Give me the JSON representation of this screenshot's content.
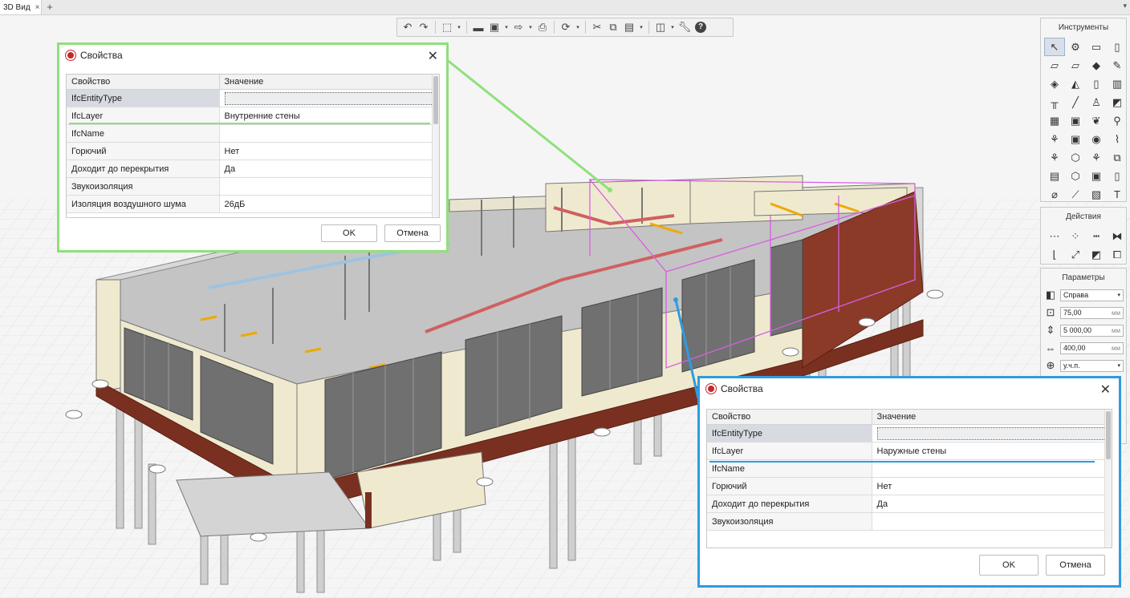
{
  "tab": {
    "label": "3D Вид",
    "close": "×",
    "add": "+",
    "menu": "▾"
  },
  "toolbar": {
    "icons": [
      "undo-icon",
      "redo-icon",
      "view-cube-icon",
      "folder-icon",
      "save-icon",
      "export-icon",
      "print-icon",
      "orbit-icon",
      "cut-icon",
      "copy-icon",
      "paste-icon",
      "layers-icon",
      "wrench-icon",
      "help-icon"
    ]
  },
  "tools_panel": {
    "title": "Инструменты",
    "icons": [
      "↖",
      "⚙",
      "▭",
      "▯",
      "▱",
      "▱",
      "◆",
      "✎",
      "◈",
      "◭",
      "▯",
      "▥",
      "╥",
      "╱",
      "♙",
      "◩",
      "▦",
      "▣",
      "❦",
      "⚲",
      "⚘",
      "▣",
      "◉",
      "⌇",
      "⚘",
      "⬡",
      "⚘",
      "⧉",
      "▤",
      "⬡",
      "▣",
      "▯",
      "⌀",
      "⟋",
      "▧",
      "T"
    ]
  },
  "actions_panel": {
    "title": "Действия",
    "icons": [
      "⋯",
      "⁘",
      "┅",
      "⧓",
      "⌊",
      "⤢",
      "◩",
      "⧠"
    ]
  },
  "params_panel": {
    "title": "Параметры",
    "side": "Справа",
    "thickness": "75,00",
    "height": "5 000,00",
    "width": "400,00",
    "unit": "мм",
    "level": "у.ч.п."
  },
  "dialog_top": {
    "title": "Свойства",
    "col_property": "Свойство",
    "col_value": "Значение",
    "rows": [
      {
        "name": "IfcEntityType",
        "value": ""
      },
      {
        "name": "IfcLayer",
        "value": "Внутренние стены"
      },
      {
        "name": "IfcName",
        "value": ""
      },
      {
        "name": "Горючий",
        "value": "Нет"
      },
      {
        "name": "Доходит до перекрытия",
        "value": "Да"
      },
      {
        "name": "Звукоизоляция",
        "value": ""
      },
      {
        "name": "Изоляция воздушного шума",
        "value": "26дБ"
      }
    ],
    "ok": "OK",
    "cancel": "Отмена",
    "frame_color": "#8fe07a"
  },
  "dialog_bottom": {
    "title": "Свойства",
    "col_property": "Свойство",
    "col_value": "Значение",
    "rows": [
      {
        "name": "IfcEntityType",
        "value": ""
      },
      {
        "name": "IfcLayer",
        "value": "Наружные стены"
      },
      {
        "name": "IfcName",
        "value": ""
      },
      {
        "name": "Горючий",
        "value": "Нет"
      },
      {
        "name": "Доходит до перекрытия",
        "value": "Да"
      },
      {
        "name": "Звукоизоляция",
        "value": ""
      }
    ],
    "ok": "OK",
    "cancel": "Отмена",
    "frame_color": "#2f9be0"
  }
}
